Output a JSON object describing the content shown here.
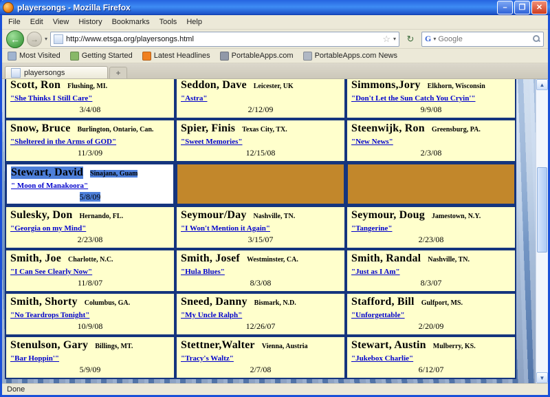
{
  "window": {
    "title": "playersongs - Mozilla Firefox"
  },
  "icons": {
    "minimize": "–",
    "maximize": "❐",
    "close": "✕",
    "back": "←",
    "forward": "→",
    "dropdown": "▾",
    "star": "☆",
    "reload": "↻",
    "scroll_up": "▲",
    "scroll_down": "▼"
  },
  "menu": {
    "items": [
      "File",
      "Edit",
      "View",
      "History",
      "Bookmarks",
      "Tools",
      "Help"
    ]
  },
  "toolbar": {
    "url": "http://www.etsga.org/playersongs.html",
    "search_placeholder": "Google",
    "search_logo": "G"
  },
  "bookmarks_bar": {
    "items": [
      {
        "label": "Most Visited",
        "icon": "most-visited-icon"
      },
      {
        "label": "Getting Started",
        "icon": "getting-started-icon"
      },
      {
        "label": "Latest Headlines",
        "icon": "latest-headlines-icon"
      },
      {
        "label": "PortableApps.com",
        "icon": "portableapps-icon"
      },
      {
        "label": "PortableApps.com News",
        "icon": "portableapps-news-icon"
      }
    ]
  },
  "tab_bar": {
    "tabs": [
      {
        "label": "playersongs"
      }
    ],
    "new_tab_label": "+"
  },
  "status_bar": {
    "text": "Done"
  },
  "colors": {
    "cell_background": "#FFFFCC",
    "cell_border_blue": "#15357E",
    "selected_row_orange": "#C2872B",
    "text_selection_blue": "#4D7FD9",
    "link_blue": "#0000CC"
  },
  "grid": {
    "rows": [
      [
        {
          "name": "Scott, Ron",
          "location": "Flushing, MI.",
          "song": "\"She Thinks I Still Care\"",
          "date": "3/4/08"
        },
        {
          "name": "Seddon, Dave",
          "location": "Leicester, UK",
          "song": "\"Astra\"",
          "date": "2/12/09"
        },
        {
          "name": "Simmons,Jory",
          "location": "Elkhorn, Wisconsin",
          "song": "\"Don't Let the Sun Catch You Cryin'\"",
          "date": "9/9/08"
        }
      ],
      [
        {
          "name": "Snow, Bruce",
          "location": "Burlington, Ontario, Can.",
          "song": "\"Sheltered in the Arms of GOD\"",
          "date": "11/3/09"
        },
        {
          "name": "Spier, Finis",
          "location": "Texas City, TX.",
          "song": "\"Sweet Memories\"",
          "date": "12/15/08"
        },
        {
          "name": "Steenwijk, Ron",
          "location": "Greensburg, PA.",
          "song": "\"New News\"",
          "date": "2/3/08"
        }
      ],
      [
        {
          "name": "Stewart, David",
          "location": "Sinajana, Guam",
          "song": "\" Moon of Manakoora\"",
          "date": "5/8/09",
          "state": "selected"
        },
        {
          "state": "empty"
        },
        {
          "state": "empty"
        }
      ],
      [
        {
          "name": "Sulesky, Don",
          "location": "Hernando, FL.",
          "song": "\"Georgia on my Mind\"",
          "date": "2/23/08"
        },
        {
          "name": "Seymour/Day",
          "location": "Nashville, TN.",
          "song": "\"I Won't Mention it Again\"",
          "date": "3/15/07"
        },
        {
          "name": "Seymour, Doug",
          "location": "Jamestown, N.Y.",
          "song": "\"Tangerine\"",
          "date": "2/23/08"
        }
      ],
      [
        {
          "name": "Smith, Joe",
          "location": "Charlotte, N.C.",
          "song": "\"I Can See Clearly Now\"",
          "date": "11/8/07"
        },
        {
          "name": "Smith, Josef",
          "location": "Westminster, CA.",
          "song": "\"Hula Blues\"",
          "date": "8/3/08"
        },
        {
          "name": "Smith, Randal",
          "location": "Nashville, TN.",
          "song": "\"Just as I Am\"",
          "date": "8/3/07"
        }
      ],
      [
        {
          "name": "Smith, Shorty",
          "location": "Columbus, GA.",
          "song": "\"No Teardrops Tonight\"",
          "date": "10/9/08"
        },
        {
          "name": "Sneed, Danny",
          "location": "Bismark, N.D.",
          "song": "\"My Uncle Ralph\"",
          "date": "12/26/07"
        },
        {
          "name": "Stafford, Bill",
          "location": "Gulfport, MS.",
          "song": "\"Unforgettable\"",
          "date": "2/20/09"
        }
      ],
      [
        {
          "name": "Stenulson, Gary",
          "location": "Billings, MT.",
          "song": "\"Bar Hoppin'\"",
          "date": "5/9/09"
        },
        {
          "name": "Stettner,Walter",
          "location": "Vienna, Austria",
          "song": "\"Tracy's Waltz\"",
          "date": "2/7/08"
        },
        {
          "name": "Stewart, Austin",
          "location": "Mulberry, KS.",
          "song": "\"Jukebox Charlie\"",
          "date": "6/12/07"
        }
      ]
    ]
  }
}
